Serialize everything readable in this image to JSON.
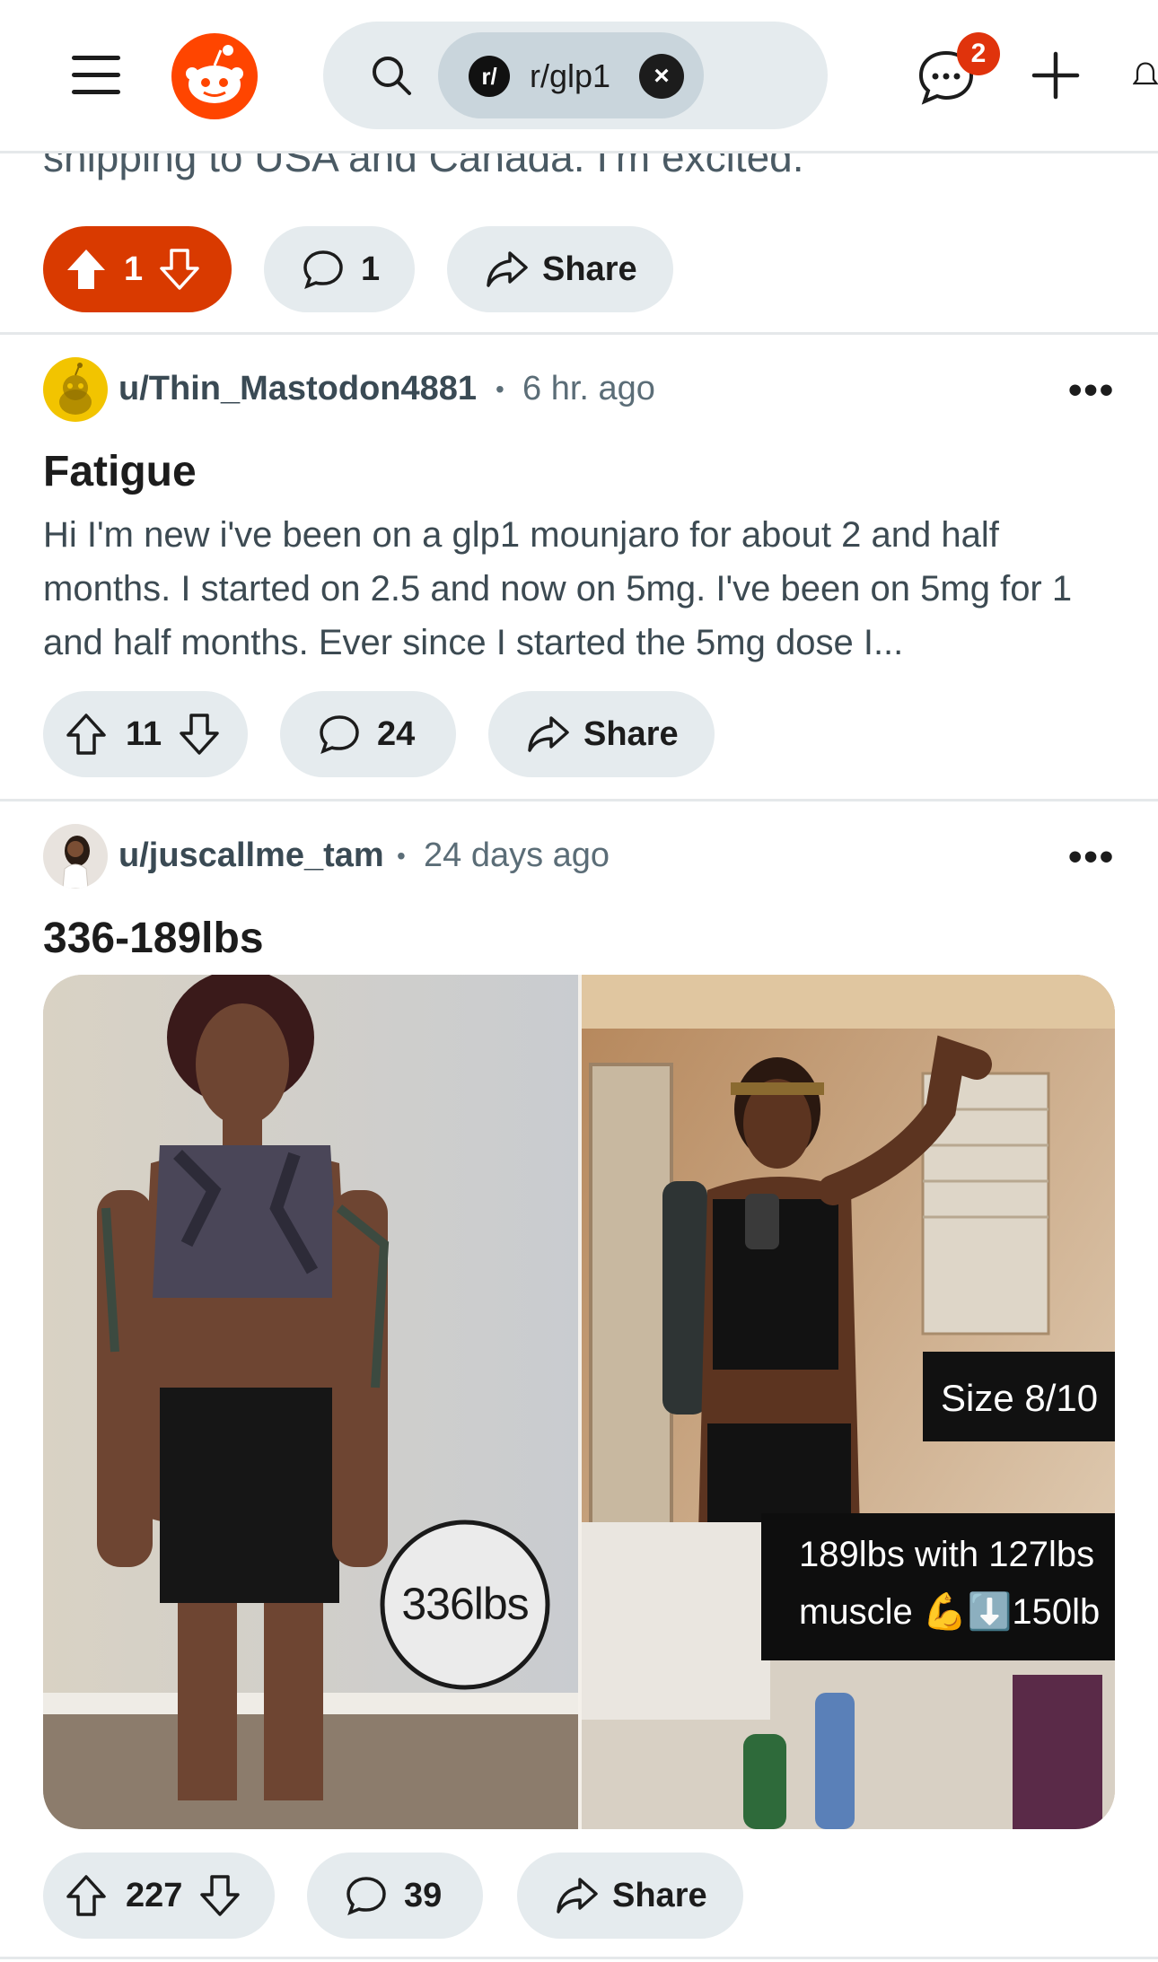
{
  "header": {
    "menu_icon": "hamburger-menu-icon",
    "logo_icon": "reddit-snoo-logo",
    "search_icon": "search-icon",
    "subreddit_chip": {
      "prefix": "r/",
      "label": "r/glp1"
    },
    "chat_badge_count": "2",
    "create_icon": "plus-icon",
    "notification_icon": "bell-icon"
  },
  "colors": {
    "brand": "#ff4500",
    "upvoted": "#d93a00",
    "pill": "#e5ebee"
  },
  "previous_post": {
    "cut_text": "shipping to USA and Canada. I'm excited.",
    "votes": "1",
    "comments": "1",
    "share_label": "Share",
    "upvoted": true
  },
  "posts": [
    {
      "username": "u/Thin_Mastodon4881",
      "separator": "•",
      "time": "6 hr. ago",
      "title": "Fatigue",
      "body": "Hi I'm new i've been on a glp1 mounjaro for about 2 and half months. I started on 2.5 and now on 5mg. I've been on 5mg for 1 and half months. Ever since I started the 5mg dose I...",
      "votes": "11",
      "comments": "24",
      "share_label": "Share"
    },
    {
      "username": "u/juscallme_tam",
      "separator": "•",
      "time": "24 days ago",
      "title": "336-189lbs",
      "image_overlays": {
        "before_weight": "336lbs",
        "size": "Size 8/10",
        "after_line1": "189lbs with 127lbs",
        "after_line2": "muscle 💪⬇️150lb"
      },
      "votes": "227",
      "comments": "39",
      "share_label": "Share"
    }
  ],
  "more_label": "•••"
}
